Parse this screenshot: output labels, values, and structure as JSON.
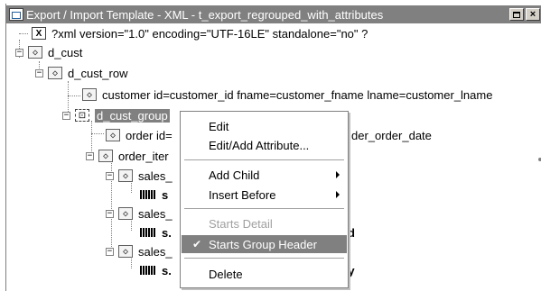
{
  "window": {
    "title": "Export / Import Template - XML - t_export_regrouped_with_attributes",
    "restore_label": "",
    "close_label": "×"
  },
  "tree": {
    "xml_decl": "?xml version=\"1.0\" encoding=\"UTF-16LE\" standalone=\"no\" ?",
    "d_cust": "d_cust",
    "d_cust_row": "d_cust_row",
    "customer": "customer id=customer_id fname=customer_fname lname=customer_lname",
    "d_cust_group": "d_cust_group",
    "order_prefix": "order id=",
    "order_suffix": "der_order_date",
    "order_items": "order_iter",
    "sales_1": "sales_",
    "sales_1_data_start": "s",
    "sales_2": "sales_",
    "sales_2_data_start": "s.",
    "sales_2_data_end": "d",
    "sales_3": "sales_",
    "sales_3_data_start": "s.",
    "sales_3_data_end": "ty",
    "expander_minus": "−"
  },
  "context_menu": {
    "items": [
      {
        "label": "Edit",
        "enabled": true
      },
      {
        "label": "Edit/Add Attribute...",
        "enabled": true
      },
      {
        "label": "Add Child",
        "enabled": true,
        "submenu": true
      },
      {
        "label": "Insert Before",
        "enabled": true,
        "submenu": true
      },
      {
        "label": "Starts Detail",
        "enabled": false
      },
      {
        "label": "Starts Group Header",
        "enabled": true,
        "checked": true,
        "highlighted": true
      },
      {
        "label": "Delete",
        "enabled": true
      }
    ],
    "check_glyph": "✔"
  },
  "colors": {
    "titlebar": "#808080",
    "selection": "#808080"
  }
}
